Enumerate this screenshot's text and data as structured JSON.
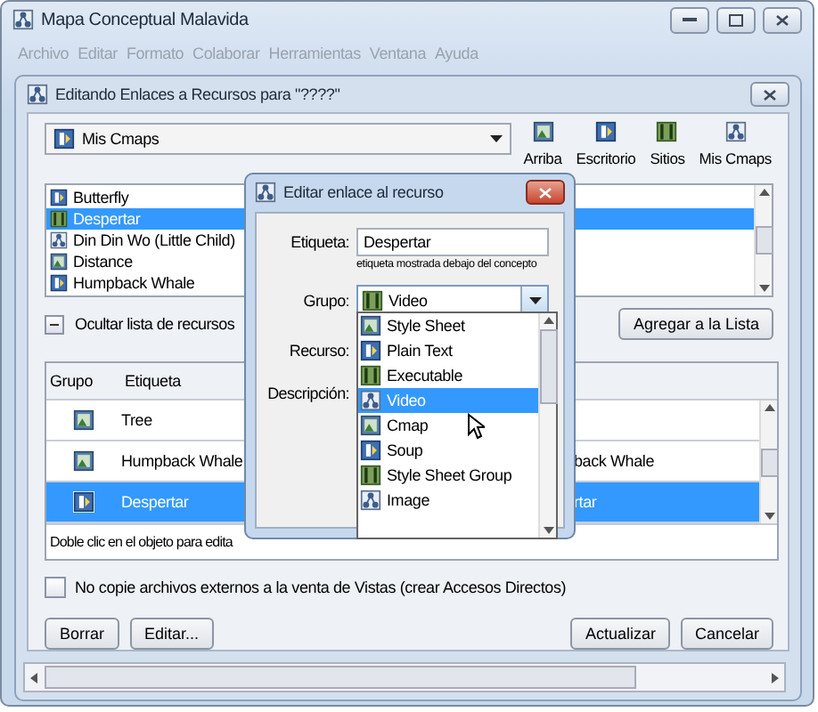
{
  "window": {
    "title": "Mapa Conceptual Malavida"
  },
  "menu": [
    {
      "label": "Archivo",
      "disabled": true
    },
    {
      "label": "Editar",
      "disabled": true
    },
    {
      "label": "Formato",
      "disabled": true
    },
    {
      "label": "Colaborar",
      "disabled": true
    },
    {
      "label": "Herramientas",
      "disabled": true
    },
    {
      "label": "Ventana",
      "disabled": true
    },
    {
      "label": "Ayuda",
      "disabled": true
    }
  ],
  "dialog": {
    "title": "Editando Enlaces a Recursos para \"????\"",
    "location": {
      "value": "Mis Cmaps"
    },
    "toolbar": [
      {
        "label": "Arriba"
      },
      {
        "label": "Escritorio"
      },
      {
        "label": "Sitios"
      },
      {
        "label": "Mis Cmaps"
      }
    ],
    "resources": [
      {
        "label": "Butterfly",
        "selected": false
      },
      {
        "label": "Despertar",
        "selected": true
      },
      {
        "label": "Din Din Wo (Little Child)",
        "selected": false
      },
      {
        "label": "Distance",
        "selected": false
      },
      {
        "label": "Humpback Whale",
        "selected": false
      }
    ],
    "toggle_label": "Ocultar lista de recursos",
    "add_button": "Agregar a la Lista",
    "table": {
      "columns": [
        "Grupo",
        "Etiqueta"
      ],
      "rows": [
        {
          "etiqueta": "Tree",
          "selected": false
        },
        {
          "etiqueta": "Humpback Whale",
          "column_3": "back Whale",
          "selected": false
        },
        {
          "etiqueta": "Despertar",
          "column_3": "rtar",
          "selected": true
        }
      ]
    },
    "status": "Doble clic en el objeto para edita",
    "copy_option": {
      "label": "No copie archivos externos a la venta de Vistas (crear Accesos Directos)",
      "checked": false
    },
    "buttons_left": [
      "Borrar",
      "Editar..."
    ],
    "buttons_right": [
      "Actualizar",
      "Cancelar"
    ]
  },
  "edit_dialog": {
    "title": "Editar enlace al recurso",
    "etiqueta": {
      "label": "Etiqueta:",
      "value": "Despertar",
      "hint": "etiqueta mostrada debajo del concepto"
    },
    "grupo": {
      "label": "Grupo:",
      "value": "Video"
    },
    "recurso": {
      "label": "Recurso:"
    },
    "descripcion": {
      "label": "Descripción:"
    },
    "group_options": [
      {
        "label": "Style Sheet",
        "selected": false
      },
      {
        "label": "Plain Text",
        "selected": false
      },
      {
        "label": "Executable",
        "selected": false
      },
      {
        "label": "Video",
        "selected": true
      },
      {
        "label": "Cmap",
        "selected": false
      },
      {
        "label": "Soup",
        "selected": false
      },
      {
        "label": "Style Sheet Group",
        "selected": false
      },
      {
        "label": "Image",
        "selected": false
      }
    ]
  }
}
